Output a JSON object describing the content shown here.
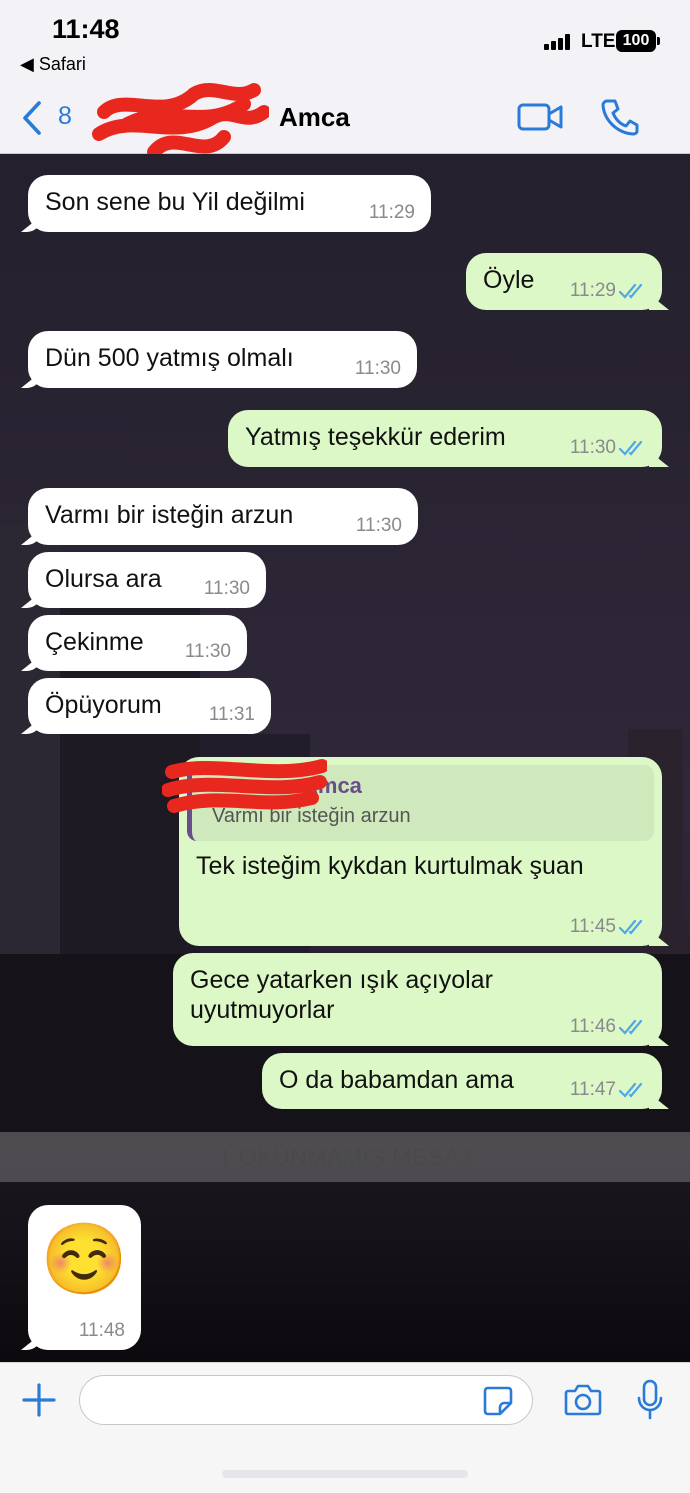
{
  "status": {
    "time": "11:48",
    "back_app": "◀ Safari",
    "network": "LTE",
    "battery": "100"
  },
  "header": {
    "unread_count": "8",
    "contact_name": "Amca"
  },
  "messages": [
    {
      "text": "Son sene bu Yil değilmi",
      "time": "11:29"
    },
    {
      "text": "Öyle",
      "time": "11:29"
    },
    {
      "text": "Dün 500 yatmış olmalı",
      "time": "11:30"
    },
    {
      "text": "Yatmış teşekkür ederim",
      "time": "11:30"
    },
    {
      "text": "Varmı bir isteğin arzun",
      "time": "11:30"
    },
    {
      "text": "Olursa ara",
      "time": "11:30"
    },
    {
      "text": "Çekinme",
      "time": "11:30"
    },
    {
      "text": "Öpüyorum",
      "time": "11:31"
    },
    {
      "reply_author": "Amca",
      "reply_text": "Varmı bir isteğin arzun",
      "text": "Tek isteğim kykdan kurtulmak şuan",
      "time": "11:45"
    },
    {
      "text": "Gece yatarken ışık açıyolar uyutmuyorlar",
      "time": "11:46"
    },
    {
      "text": "O da babamdan ama",
      "time": "11:47"
    },
    {
      "emoji": "☺️",
      "time": "11:48"
    }
  ],
  "unread_banner": "1 OKUNMAMIŞ MESAJ",
  "composer": {
    "placeholder": ""
  },
  "colors": {
    "accent": "#2a7bd8",
    "outgoing_bubble": "#dcf8c6",
    "incoming_bubble": "#ffffff",
    "read_ticks": "#4fa6e8",
    "reply_accent": "#6a4d8c",
    "redaction": "#e8281e"
  }
}
